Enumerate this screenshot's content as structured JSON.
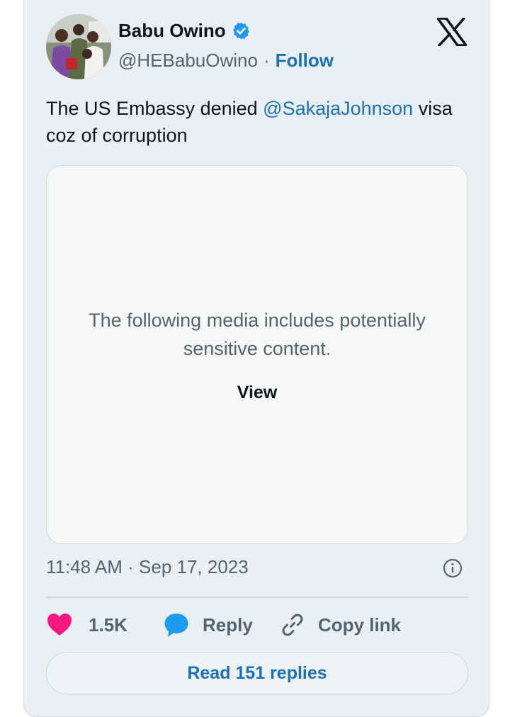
{
  "author": {
    "name": "Babu Owino",
    "handle": "@HEBabuOwino",
    "separator": "·",
    "follow_label": "Follow"
  },
  "tweet": {
    "text_before": "The US Embassy denied ",
    "mention": "@SakajaJohnson",
    "text_after": " visa coz of corruption"
  },
  "media_warning": {
    "message": "The following media includes potentially sensitive content.",
    "view_label": "View"
  },
  "timestamp": "11:48 AM · Sep 17, 2023",
  "actions": {
    "likes_count": "1.5K",
    "reply_label": "Reply",
    "copy_link_label": "Copy link"
  },
  "read_replies_label": "Read 151 replies",
  "colors": {
    "card_background": "#e9f0f5",
    "link_blue": "#1d6fb8",
    "verified_blue": "#1d9bf0",
    "like_pink": "#f91880",
    "muted_text": "#536471",
    "primary_text": "#0f1419",
    "border": "#cfd9de"
  },
  "icons": [
    "verified-badge-icon",
    "x-logo-icon",
    "info-icon",
    "heart-icon",
    "reply-bubble-icon",
    "link-icon"
  ]
}
